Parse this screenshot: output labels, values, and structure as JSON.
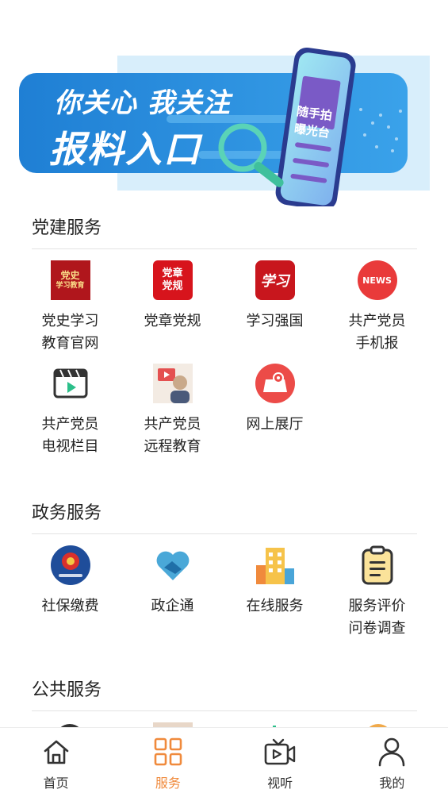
{
  "banner": {
    "headline": "你关心 我关注",
    "subline": "报料入口",
    "phone_text_1": "随手拍",
    "phone_text_2": "曝光台"
  },
  "sections": [
    {
      "title": "党建服务",
      "items": [
        {
          "label": "党史学习\n教育官网",
          "icon": "party-history-icon",
          "icon_text_1": "党史",
          "icon_text_2": "学习教育"
        },
        {
          "label": "党章党规",
          "icon": "party-rules-icon",
          "icon_text_1": "党章",
          "icon_text_2": "党规"
        },
        {
          "label": "学习强国",
          "icon": "xuexi-qiangguo-icon",
          "icon_text_1": "学习"
        },
        {
          "label": "共产党员\n手机报",
          "icon": "news-icon",
          "icon_text_1": "NEWS"
        },
        {
          "label": "共产党员\n电视栏目",
          "icon": "video-clapper-icon"
        },
        {
          "label": "共产党员\n远程教育",
          "icon": "remote-education-icon"
        },
        {
          "label": "网上展厅",
          "icon": "online-exhibition-icon"
        }
      ]
    },
    {
      "title": "政务服务",
      "items": [
        {
          "label": "社保缴费",
          "icon": "social-security-emblem-icon"
        },
        {
          "label": "政企通",
          "icon": "handshake-heart-icon"
        },
        {
          "label": "在线服务",
          "icon": "building-icon"
        },
        {
          "label": "服务评价\n问卷调查",
          "icon": "clipboard-icon"
        }
      ]
    },
    {
      "title": "公共服务",
      "items": []
    }
  ],
  "tabbar": {
    "items": [
      {
        "label": "首页",
        "icon": "home-icon"
      },
      {
        "label": "服务",
        "icon": "grid-icon",
        "active": true
      },
      {
        "label": "视听",
        "icon": "tv-play-icon"
      },
      {
        "label": "我的",
        "icon": "user-icon"
      }
    ]
  },
  "colors": {
    "accent": "#f08a3c",
    "banner_blue": "#2f86d6",
    "party_red": "#c8161d"
  }
}
